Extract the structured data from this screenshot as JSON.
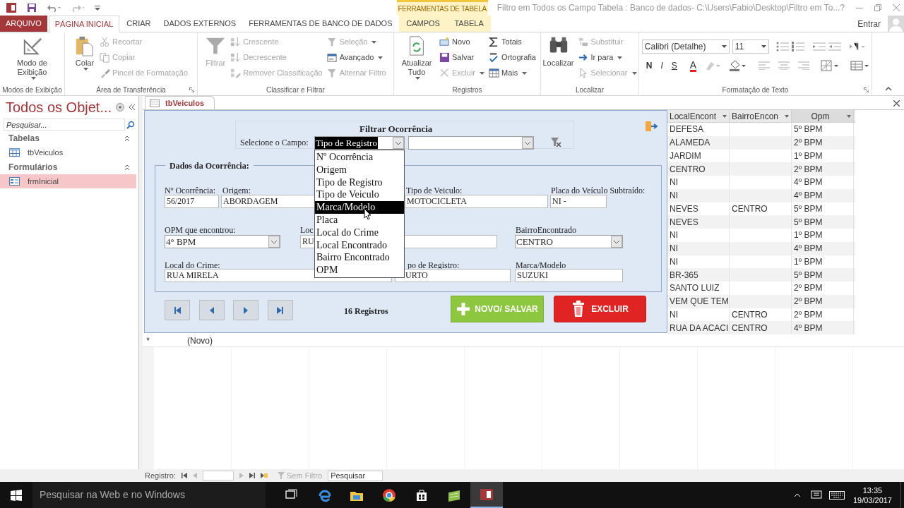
{
  "window": {
    "context_group": "FERRAMENTAS DE TABELA",
    "title": "Filtro em Todos os Campo Tabela : Banco de dados- C:\\Users\\Fabio\\Desktop\\Filtro em To...",
    "help": "?"
  },
  "ribbon_tabs": [
    {
      "label": "ARQUIVO",
      "kind": "file",
      "selected": false
    },
    {
      "label": "PÁGINA INICIAL",
      "kind": "normal",
      "selected": true
    },
    {
      "label": "CRIAR",
      "kind": "normal",
      "selected": false
    },
    {
      "label": "DADOS EXTERNOS",
      "kind": "normal",
      "selected": false
    },
    {
      "label": "FERRAMENTAS DE BANCO DE DADOS",
      "kind": "normal",
      "selected": false
    },
    {
      "label": "CAMPOS",
      "kind": "context",
      "selected": false
    },
    {
      "label": "TABELA",
      "kind": "context",
      "selected": false
    }
  ],
  "sign_in": "Entrar",
  "ribbon_groups": [
    {
      "name": "Modos de Exibição",
      "columns": [
        [
          {
            "label": "Modo de Exibição",
            "disabled": false,
            "dropdown": true
          }
        ]
      ]
    },
    {
      "name": "Área de Transferência",
      "launcher": true,
      "columns": [
        [
          {
            "label": "Colar",
            "disabled": false,
            "dropdown": true
          }
        ],
        [
          {
            "label": "Recortar",
            "disabled": true
          },
          {
            "label": "Copiar",
            "disabled": true
          },
          {
            "label": "Pincel de Formatação",
            "disabled": true
          }
        ]
      ]
    },
    {
      "name": "Classificar e Filtrar",
      "columns": [
        [
          {
            "label": "Filtrar",
            "disabled": true
          }
        ],
        [
          {
            "label": "Crescente",
            "disabled": true
          },
          {
            "label": "Decrescente",
            "disabled": true
          },
          {
            "label": "Remover Classificação",
            "disabled": true
          }
        ],
        [
          {
            "label": "Seleção",
            "disabled": true,
            "dropdown": true
          },
          {
            "label": "Avançado",
            "disabled": false,
            "dropdown": true
          },
          {
            "label": "Alternar Filtro",
            "disabled": true
          }
        ]
      ]
    },
    {
      "name": "Registros",
      "columns": [
        [
          {
            "label": "Atualizar Tudo",
            "disabled": false,
            "dropdown": true
          }
        ],
        [
          {
            "label": "Novo",
            "disabled": false
          },
          {
            "label": "Salvar",
            "disabled": false
          },
          {
            "label": "Excluir",
            "disabled": true,
            "dropdown": true
          }
        ],
        [
          {
            "label": "Totais",
            "disabled": false
          },
          {
            "label": "Ortografia",
            "disabled": false
          },
          {
            "label": "Mais",
            "disabled": false,
            "dropdown": true
          }
        ]
      ]
    },
    {
      "name": "Localizar",
      "columns": [
        [
          {
            "label": "Localizar",
            "disabled": false
          }
        ],
        [
          {
            "label": "Substituir",
            "disabled": true
          },
          {
            "label": "Ir para",
            "disabled": false,
            "dropdown": true
          },
          {
            "label": "Selecionar",
            "disabled": true,
            "dropdown": true
          }
        ]
      ]
    },
    {
      "name": "Formatação de Texto",
      "launcher": true,
      "font": "Calibri (Detalhe)",
      "font_size": "11",
      "bold": "N",
      "italic": "I",
      "underline": "S",
      "font_color": "A"
    }
  ],
  "nav_pane": {
    "title": "Todos os Objet...",
    "search_placeholder": "Pesquisar...",
    "groups": [
      {
        "name": "Tabelas",
        "expanded": true,
        "items": [
          {
            "label": "tbVeiculos",
            "kind": "table",
            "selected": false
          }
        ]
      },
      {
        "name": "Formulários",
        "expanded": true,
        "items": [
          {
            "label": "frmInicial",
            "kind": "form",
            "selected": true
          }
        ]
      }
    ]
  },
  "document_tab": "tbVeiculos",
  "form": {
    "title": "Filtrar Ocorrência",
    "field_label": "Selecione o Campo:",
    "field_value": "Tipo de Registro",
    "field_value_highlighted": true,
    "field_options": [
      {
        "label": "Nº Ocorrência",
        "selected": false
      },
      {
        "label": "Origem",
        "selected": false
      },
      {
        "label": "Tipo de Registro",
        "selected": false
      },
      {
        "label": "Tipo de Veiculo",
        "selected": false
      },
      {
        "label": "Marca/Modelo",
        "selected": true
      },
      {
        "label": "Placa",
        "selected": false
      },
      {
        "label": "Local do Crime",
        "selected": false
      },
      {
        "label": "Local Encontrado",
        "selected": false
      },
      {
        "label": "Bairro Encontrado",
        "selected": false
      },
      {
        "label": "OPM",
        "selected": false
      }
    ],
    "section": "Dados da Ocorrência:",
    "fields": [
      {
        "label": "Nº Ocorrência:",
        "value": "56/2017",
        "kind": "text"
      },
      {
        "label": "Origem:",
        "value": "ABORDAGEM",
        "kind": "text"
      },
      {
        "label": "Tipo de Veiculo:",
        "value": "MOTOCICLETA",
        "kind": "text"
      },
      {
        "label": "Placa do Veículo Subtraído:",
        "value": "NI -",
        "kind": "text"
      },
      {
        "label": "OPM que encontrou:",
        "value": "4° BPM",
        "kind": "combo"
      },
      {
        "label": "Loc",
        "value": "RU",
        "kind": "text"
      },
      {
        "label": "BairroEncontrado",
        "value": "CENTRO",
        "kind": "combo"
      },
      {
        "label": "Local do Crime:",
        "value": "RUA MIRELA",
        "kind": "text"
      },
      {
        "label": "po de Registro:",
        "value": "URTO",
        "kind": "text"
      },
      {
        "label": "Marca/Modelo",
        "value": "SUZUKI",
        "kind": "text"
      }
    ],
    "record_count": "16 Registros",
    "save_button": "NOVO/ SALVAR",
    "delete_button": "EXCLUIR"
  },
  "datasheet": {
    "columns": [
      "LocalEncont",
      "BairroEncon",
      "Opm"
    ],
    "rows": [
      [
        "DEFESA",
        "",
        "5º BPM"
      ],
      [
        "ALAMEDA",
        "",
        "2º BPM"
      ],
      [
        "JARDIM",
        "",
        "1º BPM"
      ],
      [
        "CENTRO",
        "",
        "2º BPM"
      ],
      [
        "NI",
        "",
        "4º BPM"
      ],
      [
        "NI",
        "",
        "4º BPM"
      ],
      [
        "NEVES",
        "CENTRO",
        "5º BPM"
      ],
      [
        "NEVES",
        "",
        "5º BPM"
      ],
      [
        "NI",
        "",
        "1º BPM"
      ],
      [
        "NI",
        "",
        "4º BPM"
      ],
      [
        "NI",
        "",
        "1º BPM"
      ],
      [
        "BR-365",
        "",
        "5º BPM"
      ],
      [
        "SANTO LUIZ",
        "",
        "2º BPM"
      ],
      [
        "VEM QUE TEM",
        "",
        "2º BPM"
      ],
      [
        "NI",
        "CENTRO",
        "2º BPM"
      ],
      [
        "RUA DA ACACI",
        "CENTRO",
        "4º BPM"
      ]
    ],
    "new_row_marker": "*",
    "new_row": "(Novo)"
  },
  "record_nav": {
    "label": "Registro:",
    "filter": "Sem Filtro",
    "search": "Pesquisar"
  },
  "taskbar": {
    "search": "Pesquisar na Web e no Windows",
    "time": "13:35",
    "date": "19/03/2017",
    "apps": [
      {
        "kind": "taskview",
        "active": false
      },
      {
        "kind": "edge",
        "active": false
      },
      {
        "kind": "explorer",
        "active": false
      },
      {
        "kind": "chrome",
        "active": false
      },
      {
        "kind": "store",
        "active": false
      },
      {
        "kind": "green",
        "active": false
      },
      {
        "kind": "access",
        "active": true
      }
    ]
  }
}
